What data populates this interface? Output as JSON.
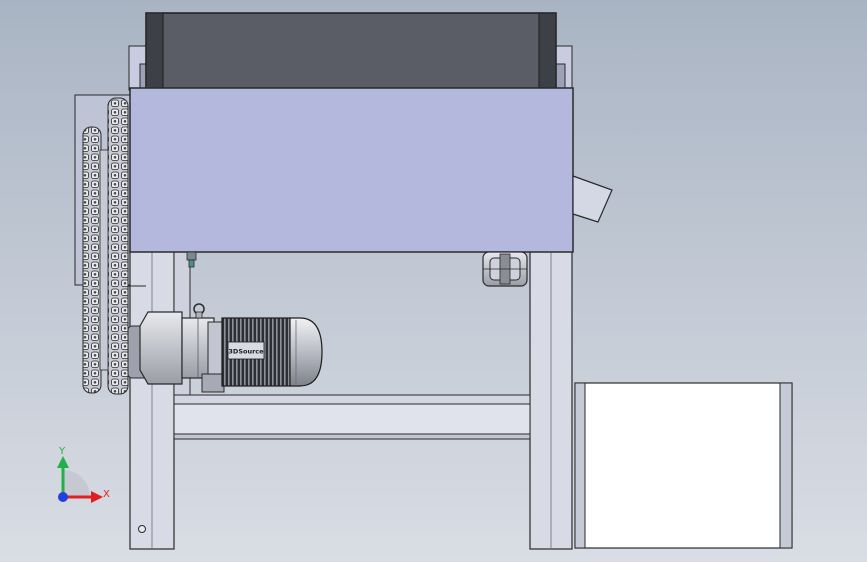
{
  "motor": {
    "brand_label": "3DSource"
  },
  "triad": {
    "x_label": "X",
    "y_label": "Y",
    "x_color": "#e02020",
    "y_color": "#22b04a",
    "z_color": "#2040e0"
  },
  "colors": {
    "hopper_body": "#b3b8dc",
    "belt_dark": "#5a5c66",
    "frame_fill": "#d8dae6",
    "outline": "#2a2a2a",
    "box_fill": "#ffffff"
  }
}
